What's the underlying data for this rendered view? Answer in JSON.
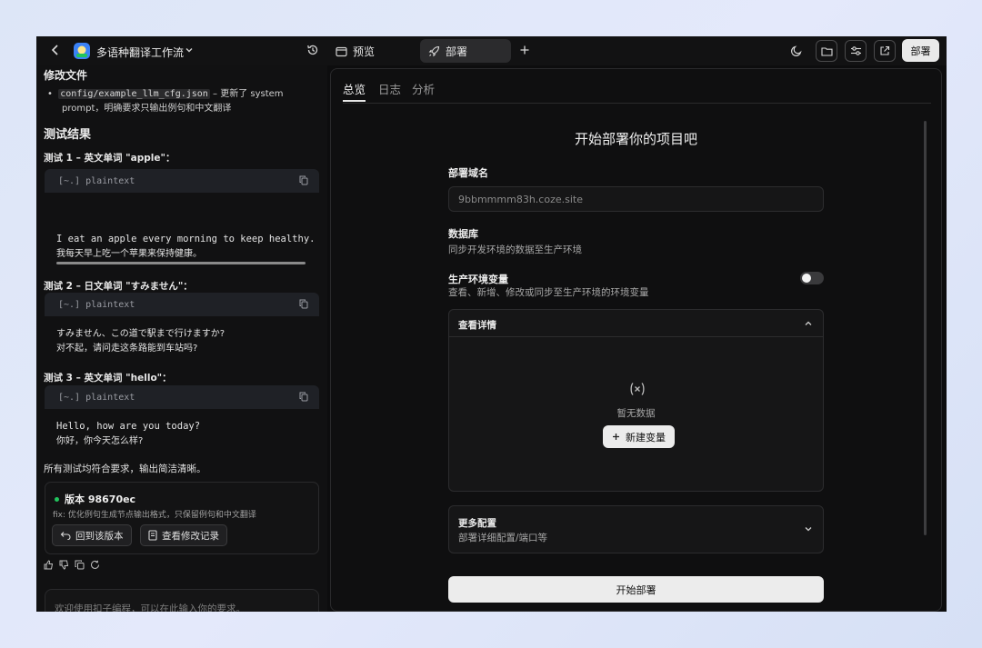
{
  "topbar": {
    "project_title": "多语种翻译工作流",
    "tab_preview": "预览",
    "tab_deploy": "部署",
    "deploy_button": "部署"
  },
  "left": {
    "modified_heading": "修改文件",
    "modified_file": "config/example_llm_cfg.json",
    "modified_desc_1": "– 更新了 system",
    "modified_desc_2": "prompt，明确要求只输出例句和中文翻译",
    "results_heading": "测试结果",
    "tests": [
      {
        "title": "测试 1 – 英文单词 \"apple\"：",
        "lang": "plaintext",
        "line1": "I eat an apple every morning to keep healthy.",
        "line2": "我每天早上吃一个苹果来保持健康。"
      },
      {
        "title": "测试 2 – 日文单词 \"すみません\"：",
        "lang": "plaintext",
        "line1": "すみません、この道で駅まで行けますか?",
        "line2": "对不起，请问走这条路能到车站吗?"
      },
      {
        "title": "测试 3 – 英文单词 \"hello\"：",
        "lang": "plaintext",
        "line1": "Hello, how are you today?",
        "line2": "你好，你今天怎么样?"
      }
    ],
    "summary": "所有测试均符合要求，输出简洁清晰。",
    "version": {
      "label": "版本 98670ec",
      "desc": "fix: 优化例句生成节点输出格式，只保留例句和中文翻译",
      "revert_button": "回到该版本",
      "history_button": "查看修改记录",
      "dot_color": "#22c55e"
    },
    "input_placeholder": "欢迎使用扣子编程，可以在此输入你的要求。"
  },
  "right": {
    "tabs": [
      "总览",
      "日志",
      "分析"
    ],
    "heading": "开始部署你的项目吧",
    "domain_label": "部署域名",
    "domain_value": "9bbmmmm83h.coze.site",
    "db_label": "数据库",
    "db_desc": "同步开发环境的数据至生产环境",
    "db_sync_enabled": false,
    "env_label": "生产环境变量",
    "env_desc": "查看、新增、修改或同步至生产环境的环境变量",
    "details_title": "查看详情",
    "empty_text": "暂无数据",
    "new_var_button": "新建变量",
    "more_title": "更多配置",
    "more_desc": "部署详细配置/端口等",
    "start_button": "开始部署"
  }
}
